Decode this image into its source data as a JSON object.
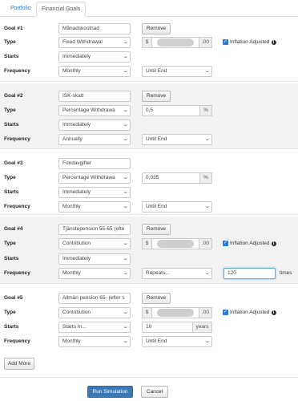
{
  "tabs": [
    {
      "label": "Portfolio",
      "active": false
    },
    {
      "label": "Financial Goals",
      "active": true
    }
  ],
  "labels": {
    "type": "Type",
    "starts": "Starts",
    "frequency": "Frequency",
    "remove": "Remove",
    "inflation": "Inflation Adjusted",
    "currency": "$",
    "cents": ".00",
    "percent": "%",
    "years": "years",
    "times": "times"
  },
  "goals": [
    {
      "title": "Goal #1",
      "name": "Månadskostnad",
      "type": "Fixed Withdrawal",
      "starts": "Immediately",
      "frequency": "Monthly",
      "until": "Until End",
      "inflation_adjusted": true
    },
    {
      "title": "Goal #2",
      "name": "ISK-skatt",
      "type": "Percentage Withdrawa",
      "percent_value": "0,5",
      "starts": "Immediately",
      "frequency": "Annually",
      "until": "Until End"
    },
    {
      "title": "Goal #3",
      "name": "Fondavgifter",
      "type": "Percentage Withdrawa",
      "percent_value": "0,035",
      "starts": "Immediately",
      "frequency": "Monthly",
      "until": "Until End"
    },
    {
      "title": "Goal #4",
      "name": "Tjänstepension 55-65 (efte",
      "type": "Contribution",
      "starts": "Immediately",
      "frequency": "Monthly",
      "until": "Repeats...",
      "repeat_count": "120",
      "inflation_adjusted": true
    },
    {
      "title": "Goal #5",
      "name": "Allmän pension 65- (efter s",
      "type": "Contribution",
      "starts": "Starts In...",
      "starts_in_value": "10",
      "frequency": "Monthly",
      "until": "Until End",
      "inflation_adjusted": true
    }
  ],
  "buttons": {
    "add_more": "Add More",
    "run_simulation": "Run Simulation",
    "cancel": "Cancel"
  },
  "colors": {
    "primary": "#3a79b8",
    "link": "#337ab7",
    "alt_row": "#f2f2f2"
  }
}
